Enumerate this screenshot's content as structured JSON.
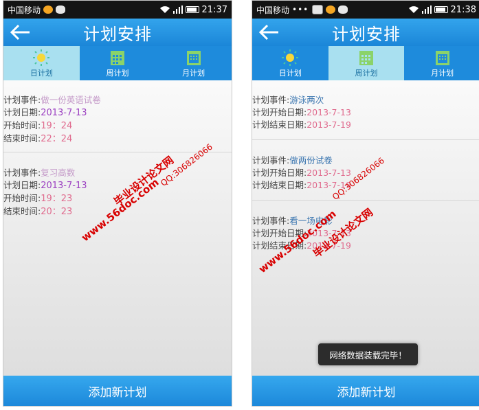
{
  "left": {
    "status": {
      "carrier": "中国移动",
      "time": "21:37"
    },
    "title": "计划安排",
    "tabs": [
      {
        "label": "日计划"
      },
      {
        "label": "周计划"
      },
      {
        "label": "月计划"
      }
    ],
    "active_tab": "日计划",
    "entries": [
      {
        "event_label": "计划事件:",
        "event": "做一份英语试卷",
        "date_label": "计划日期:",
        "date": "2013-7-13",
        "start_label": "开始时间:",
        "start": "19：24",
        "end_label": "结束时间:",
        "end": "22：24"
      },
      {
        "event_label": "计划事件:",
        "event": "复习高数",
        "date_label": "计划日期:",
        "date": "2013-7-13",
        "start_label": "开始时间:",
        "start": "19：23",
        "end_label": "结束时间:",
        "end": "20：23"
      }
    ],
    "bottom_button": "添加新计划",
    "watermark": {
      "site_name": "毕业设计论文网",
      "url": "www.56doc.com",
      "qq": "QQ:306826066"
    }
  },
  "right": {
    "status": {
      "carrier": "中国移动",
      "dots": "•••",
      "time": "21:38"
    },
    "title": "计划安排",
    "tabs": [
      {
        "label": "日计划"
      },
      {
        "label": "周计划"
      },
      {
        "label": "月计划"
      }
    ],
    "active_tab": "周计划",
    "entries": [
      {
        "event_label": "计划事件:",
        "event": "游泳两次",
        "start_label": "计划开始日期:",
        "start": "2013-7-13",
        "end_label": "计划结束日期:",
        "end": "2013-7-19"
      },
      {
        "event_label": "计划事件:",
        "event": "做两份试卷",
        "start_label": "计划开始日期:",
        "start": "2013-7-13",
        "end_label": "计划结束日期:",
        "end": "2013-7-19"
      },
      {
        "event_label": "计划事件:",
        "event": "看一场电影",
        "start_label": "计划开始日期:",
        "start": "2013-7-13",
        "end_label": "计划结束日期:",
        "end": "2013-7-19"
      }
    ],
    "toast": "网络数据装载完毕！",
    "bottom_button": "添加新计划",
    "watermark": {
      "site_name": "毕业设计论文网",
      "url": "www.56doc.com",
      "qq": "QQ:306826066"
    }
  },
  "colors": {
    "accent": "#1e8bdc",
    "active_tab": "#a9e0f0",
    "watermark": "#d80000"
  },
  "icons": {
    "back": "arrow-left-icon",
    "day": "sun-icon",
    "week": "calendar-grid-icon",
    "month": "calendar-icon"
  }
}
